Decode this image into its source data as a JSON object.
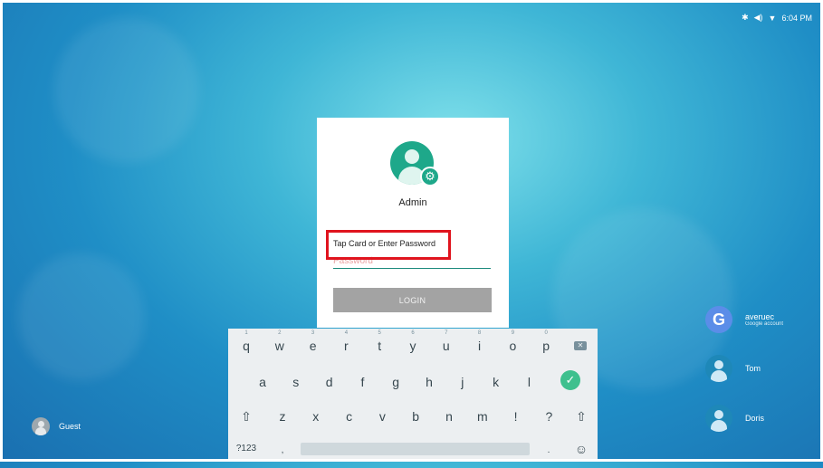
{
  "status_bar": {
    "icons": [
      "bluetooth-icon",
      "volume-icon",
      "wifi-icon"
    ],
    "time": "6:04 PM"
  },
  "login": {
    "username": "Admin",
    "password_label": "Tap Card or Enter Password",
    "password_placeholder": "Password",
    "password_value": "",
    "login_label": "LOGIN"
  },
  "keyboard": {
    "row1": [
      {
        "key": "q",
        "hint": "1"
      },
      {
        "key": "w",
        "hint": "2"
      },
      {
        "key": "e",
        "hint": "3"
      },
      {
        "key": "r",
        "hint": "4"
      },
      {
        "key": "t",
        "hint": "5"
      },
      {
        "key": "y",
        "hint": "6"
      },
      {
        "key": "u",
        "hint": "7"
      },
      {
        "key": "i",
        "hint": "8"
      },
      {
        "key": "o",
        "hint": "9"
      },
      {
        "key": "p",
        "hint": "0"
      }
    ],
    "row2": [
      "a",
      "s",
      "d",
      "f",
      "g",
      "h",
      "j",
      "k",
      "l"
    ],
    "row3": [
      "z",
      "x",
      "c",
      "v",
      "b",
      "n",
      "m",
      "!",
      "?"
    ],
    "symbols_label": "?123",
    "comma": ",",
    "period": ".",
    "emoji": "☺",
    "check": "✓",
    "shift": "⇧"
  },
  "users": [
    {
      "name": "averuec",
      "subtitle": "Google account",
      "icon": "google-icon"
    },
    {
      "name": "Tom",
      "icon": "user-icon"
    },
    {
      "name": "Doris",
      "icon": "user-icon"
    }
  ],
  "guest": {
    "name": "Guest",
    "icon": "user-icon"
  },
  "colors": {
    "accent_green": "#1ea88a",
    "highlight_red": "#e0141e",
    "login_button": "#a3a3a3"
  }
}
